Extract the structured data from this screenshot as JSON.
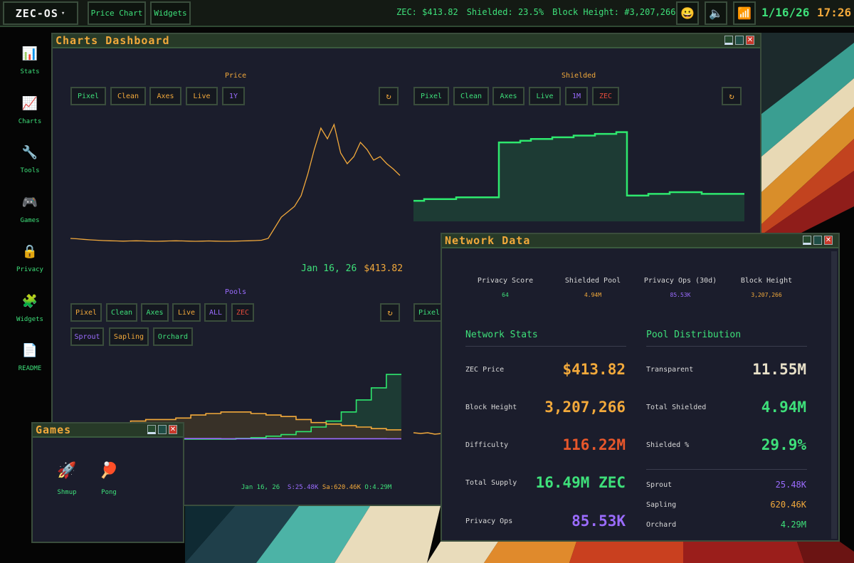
{
  "taskbar": {
    "brand": "ZEC-OS",
    "caret": "▾",
    "apps": [
      "Price Chart",
      "Widgets"
    ],
    "status": {
      "zec": "ZEC: $413.82",
      "shielded": "Shielded: 23.5%",
      "block": "Block Height: #3,207,266"
    },
    "icons": [
      "smiley-icon",
      "speaker-icon",
      "signal-icon"
    ],
    "date": "1/16/26",
    "time": "17:26"
  },
  "sidebar": {
    "items": [
      {
        "label": "Stats",
        "icon": "bar-chart-icon"
      },
      {
        "label": "Charts",
        "icon": "line-chart-icon"
      },
      {
        "label": "Tools",
        "icon": "wrench-icon"
      },
      {
        "label": "Games",
        "icon": "gamepad-icon"
      },
      {
        "label": "Privacy",
        "icon": "lock-icon"
      },
      {
        "label": "Widgets",
        "icon": "puzzle-icon"
      },
      {
        "label": "README",
        "icon": "document-icon"
      }
    ]
  },
  "dashboard": {
    "title": "Charts Dashboard",
    "price": {
      "title": "Price",
      "buttons": [
        "Pixel",
        "Clean",
        "Axes",
        "Live",
        "1Y"
      ],
      "refresh": "↻",
      "readout_date": "Jan 16, 26",
      "readout_value": "$413.82"
    },
    "shielded": {
      "title": "Shielded",
      "buttons": [
        "Pixel",
        "Clean",
        "Axes",
        "Live",
        "1M",
        "ZEC"
      ],
      "refresh": "↻"
    },
    "pools": {
      "title": "Pools",
      "buttons": [
        "Pixel",
        "Clean",
        "Axes",
        "Live",
        "ALL",
        "ZEC"
      ],
      "pool_buttons": [
        "Sprout",
        "Sapling",
        "Orchard"
      ],
      "refresh": "↻",
      "readout_date": "Jan 16, 26",
      "readout_s": "S:25.48K",
      "readout_sa": "Sa:620.46K",
      "readout_o": "O:4.29M"
    },
    "hidden_panel": {
      "button": "Pixel"
    }
  },
  "games": {
    "title": "Games",
    "items": [
      {
        "label": "Shmup",
        "icon": "rocket-icon"
      },
      {
        "label": "Pong",
        "icon": "ping-pong-icon"
      }
    ]
  },
  "network": {
    "title": "Network Data",
    "kpis": [
      {
        "label": "Privacy Score",
        "value": "64"
      },
      {
        "label": "Shielded Pool",
        "value": "4.94M"
      },
      {
        "label": "Privacy Ops (30d)",
        "value": "85.53K"
      },
      {
        "label": "Block Height",
        "value": "3,207,266"
      }
    ],
    "stats_title": "Network Stats",
    "stats": [
      {
        "label": "ZEC Price",
        "value": "$413.82"
      },
      {
        "label": "Block Height",
        "value": "3,207,266"
      },
      {
        "label": "Difficulty",
        "value": "116.22M"
      },
      {
        "label": "Total Supply",
        "value": "16.49M ZEC"
      },
      {
        "label": "Privacy Ops",
        "value": "85.53K"
      }
    ],
    "pool_title": "Pool Distribution",
    "pool": [
      {
        "label": "Transparent",
        "value": "11.55M"
      },
      {
        "label": "Total Shielded",
        "value": "4.94M"
      },
      {
        "label": "Shielded %",
        "value": "29.9%"
      }
    ],
    "pool_detail": [
      {
        "label": "Sprout",
        "value": "25.48K"
      },
      {
        "label": "Sapling",
        "value": "620.46K"
      },
      {
        "label": "Orchard",
        "value": "4.29M"
      }
    ]
  },
  "colors": {
    "green": "#3ee07a",
    "orange": "#f2a93b",
    "purple": "#9b6cff",
    "red": "#e14b3b",
    "window_bg": "#1b1d2c",
    "titlebar": "#273a28"
  },
  "chart_data": [
    {
      "type": "line",
      "title": "Price",
      "x_range": [
        "Jan 2025",
        "Jan 16, 26"
      ],
      "series": [
        {
          "values": [
            60,
            58,
            55,
            52,
            50,
            48,
            47,
            46,
            45,
            46,
            47,
            46,
            45,
            44,
            45,
            46,
            47,
            46,
            45,
            44,
            45,
            46,
            45,
            44,
            44,
            45,
            46,
            47,
            48,
            50,
            60,
            120,
            180,
            210,
            240,
            300,
            420,
            560,
            680,
            620,
            700,
            540,
            480,
            520,
            600,
            560,
            500,
            520,
            480,
            450,
            413.82
          ]
        }
      ]
    },
    {
      "type": "area",
      "title": "Shielded",
      "series": [
        {
          "values": [
            1.2,
            1.3,
            1.3,
            1.3,
            1.4,
            1.4,
            1.4,
            1.4,
            4.6,
            4.6,
            4.7,
            4.8,
            4.8,
            4.9,
            4.9,
            5.0,
            5.0,
            5.1,
            5.1,
            5.2,
            1.5,
            1.5,
            1.6,
            1.6,
            1.7,
            1.7,
            1.7,
            1.6,
            1.6,
            1.6,
            1.6
          ]
        }
      ]
    },
    {
      "type": "area",
      "title": "Pools",
      "series": [
        {
          "name": "Sapling",
          "values": [
            0.5,
            0.7,
            0.9,
            1.0,
            1.2,
            1.3,
            1.3,
            1.4,
            1.6,
            1.7,
            1.8,
            1.8,
            1.7,
            1.6,
            1.5,
            1.3,
            1.1,
            1.0,
            0.9,
            0.8,
            0.7,
            0.62
          ]
        },
        {
          "name": "Orchard",
          "values": [
            0,
            0,
            0,
            0,
            0,
            0,
            0,
            0,
            0,
            0,
            0,
            0.05,
            0.1,
            0.2,
            0.3,
            0.5,
            0.8,
            1.2,
            1.8,
            2.6,
            3.4,
            4.29
          ]
        },
        {
          "name": "Sprout",
          "values": [
            0.05,
            0.05,
            0.05,
            0.05,
            0.05,
            0.04,
            0.04,
            0.04,
            0.04,
            0.04,
            0.03,
            0.03,
            0.03,
            0.03,
            0.03,
            0.03,
            0.03,
            0.03,
            0.03,
            0.03,
            0.03,
            0.025
          ]
        }
      ]
    }
  ]
}
